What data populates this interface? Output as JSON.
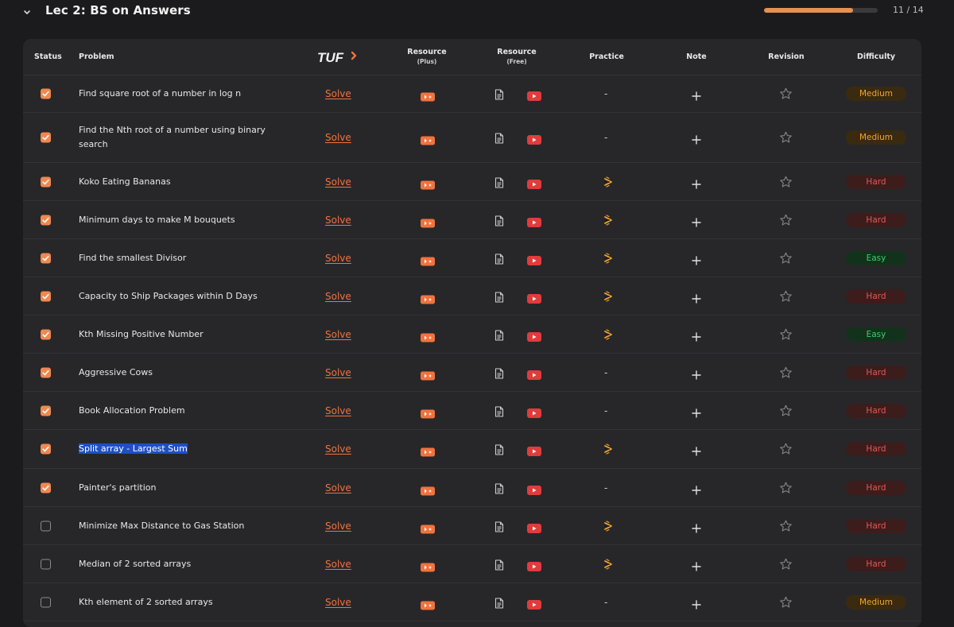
{
  "section": {
    "title": "Lec 2: BS on Answers",
    "progress_text": "11 / 14",
    "progress_fraction": 0.786
  },
  "header": {
    "status": "Status",
    "problem": "Problem",
    "tuf_logo": "TUF",
    "resource_plus": "Resource",
    "resource_plus_sub": "(Plus)",
    "resource_free": "Resource",
    "resource_free_sub": "(Free)",
    "practice": "Practice",
    "note": "Note",
    "revision": "Revision",
    "difficulty": "Difficulty"
  },
  "rows": [
    {
      "done": true,
      "problem": "Find square root of a number in log n",
      "solve": "Solve",
      "practice": "-",
      "difficulty": "Medium",
      "level": "medium"
    },
    {
      "done": true,
      "problem": "Find the Nth root of a number using binary search",
      "solve": "Solve",
      "practice": "-",
      "difficulty": "Medium",
      "level": "medium"
    },
    {
      "done": true,
      "problem": "Koko Eating Bananas",
      "solve": "Solve",
      "practice": "codingninjas-icon",
      "difficulty": "Hard",
      "level": "hard"
    },
    {
      "done": true,
      "problem": "Minimum days to make M bouquets",
      "solve": "Solve",
      "practice": "codingninjas-icon",
      "difficulty": "Hard",
      "level": "hard"
    },
    {
      "done": true,
      "problem": "Find the smallest Divisor",
      "solve": "Solve",
      "practice": "codingninjas-icon",
      "difficulty": "Easy",
      "level": "easy"
    },
    {
      "done": true,
      "problem": "Capacity to Ship Packages within D Days",
      "solve": "Solve",
      "practice": "codingninjas-icon",
      "difficulty": "Hard",
      "level": "hard"
    },
    {
      "done": true,
      "problem": "Kth Missing Positive Number",
      "solve": "Solve",
      "practice": "codingninjas-icon",
      "difficulty": "Easy",
      "level": "easy"
    },
    {
      "done": true,
      "problem": "Aggressive Cows",
      "solve": "Solve",
      "practice": "-",
      "difficulty": "Hard",
      "level": "hard"
    },
    {
      "done": true,
      "problem": "Book Allocation Problem",
      "solve": "Solve",
      "practice": "-",
      "difficulty": "Hard",
      "level": "hard"
    },
    {
      "done": true,
      "problem": "Split array - Largest Sum",
      "solve": "Solve",
      "practice": "codingninjas-icon",
      "difficulty": "Hard",
      "level": "hard",
      "highlighted": true
    },
    {
      "done": true,
      "problem": "Painter's partition",
      "solve": "Solve",
      "practice": "-",
      "difficulty": "Hard",
      "level": "hard"
    },
    {
      "done": false,
      "problem": "Minimize Max Distance to Gas Station",
      "solve": "Solve",
      "practice": "codingninjas-icon",
      "difficulty": "Hard",
      "level": "hard"
    },
    {
      "done": false,
      "problem": "Median of 2 sorted arrays",
      "solve": "Solve",
      "practice": "codingninjas-icon",
      "difficulty": "Hard",
      "level": "hard"
    },
    {
      "done": false,
      "problem": "Kth element of 2 sorted arrays",
      "solve": "Solve",
      "practice": "-",
      "difficulty": "Medium",
      "level": "medium"
    }
  ],
  "colors": {
    "accent": "#f0733d",
    "checkbox": "#f08850",
    "progress": "#e8904f",
    "medium": "#f0a530",
    "hard": "#e05a55",
    "easy": "#3fcf6a",
    "youtube": "#e03c3c"
  }
}
